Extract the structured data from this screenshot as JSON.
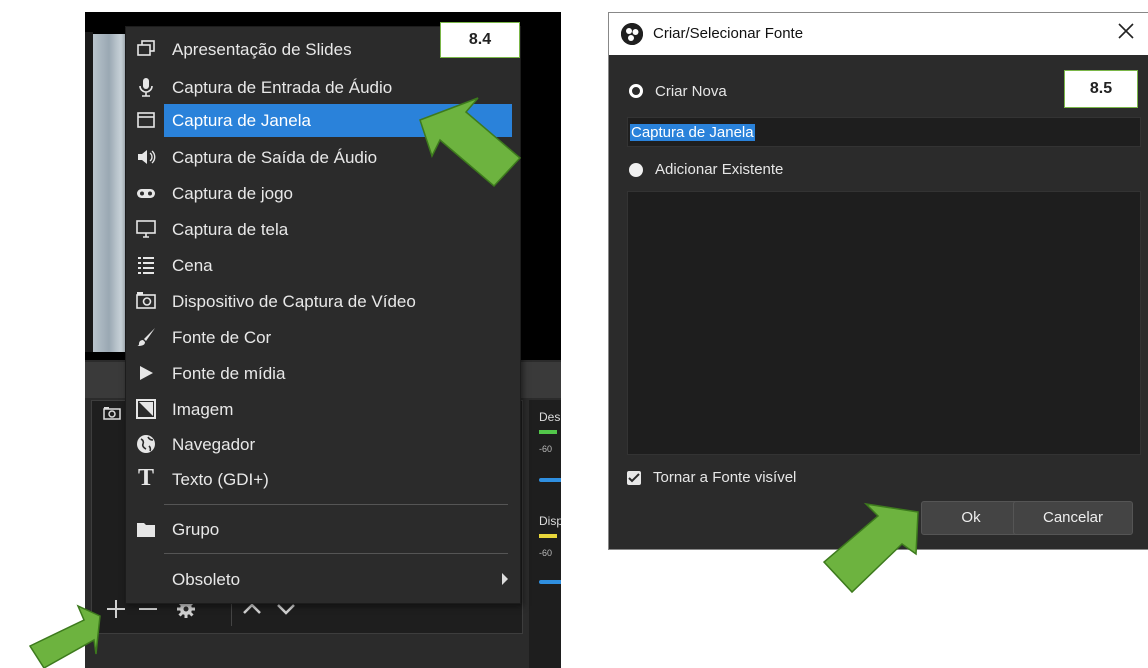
{
  "steps": {
    "left": "8.4",
    "right": "8.5"
  },
  "menu": {
    "items": [
      {
        "label": "Apresentação de Slides",
        "icon": "slideshow-icon"
      },
      {
        "label": "Captura de Entrada de Áudio",
        "icon": "microphone-icon"
      },
      {
        "label": "Captura de Janela",
        "icon": "window-icon",
        "selected": true
      },
      {
        "label": "Captura de Saída de Áudio",
        "icon": "speaker-icon"
      },
      {
        "label": "Captura de jogo",
        "icon": "gamepad-icon"
      },
      {
        "label": "Captura de tela",
        "icon": "monitor-icon"
      },
      {
        "label": "Cena",
        "icon": "list-icon"
      },
      {
        "label": "Dispositivo de Captura de Vídeo",
        "icon": "camera-icon"
      },
      {
        "label": "Fonte de Cor",
        "icon": "brush-icon"
      },
      {
        "label": "Fonte de mídia",
        "icon": "play-icon"
      },
      {
        "label": "Imagem",
        "icon": "image-icon"
      },
      {
        "label": "Navegador",
        "icon": "globe-icon"
      },
      {
        "label": "Texto (GDI+)",
        "icon": "text-icon"
      }
    ],
    "group_label": "Grupo",
    "obsolete_label": "Obsoleto"
  },
  "mixer": {
    "label1": "Des",
    "label2": "Disp",
    "db1": "-60",
    "db2": "-60"
  },
  "dialog": {
    "title": "Criar/Selecionar Fonte",
    "create_new_label": "Criar Nova",
    "name_value": "Captura de Janela",
    "add_existing_label": "Adicionar Existente",
    "visible_label": "Tornar a Fonte visível",
    "ok_label": "Ok",
    "cancel_label": "Cancelar"
  },
  "colors": {
    "accent": "#2a82da",
    "arrow": "#6db33f",
    "badge_border": "#7ab648"
  }
}
